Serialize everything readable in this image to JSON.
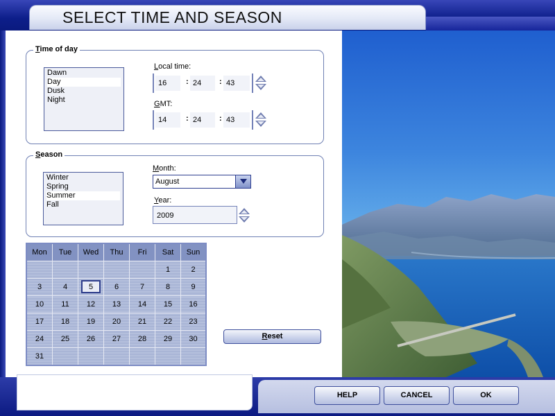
{
  "window": {
    "title": "SELECT TIME AND SEASON"
  },
  "time_of_day": {
    "legend_key": "T",
    "legend_rest": "ime of day",
    "options": [
      "Dawn",
      "Day",
      "Dusk",
      "Night"
    ],
    "selected": "Day",
    "local_time": {
      "label_key": "L",
      "label_rest": "ocal time:",
      "hours": "16",
      "minutes": "24",
      "seconds": "43"
    },
    "gmt": {
      "label_key": "G",
      "label_rest": "MT:",
      "hours": "14",
      "minutes": "24",
      "seconds": "43"
    },
    "separator": ":"
  },
  "season": {
    "legend_key": "S",
    "legend_rest": "eason",
    "options": [
      "Winter",
      "Spring",
      "Summer",
      "Fall"
    ],
    "selected": "Summer",
    "month": {
      "label_key": "M",
      "label_rest": "onth:",
      "value": "August"
    },
    "year": {
      "label_key": "Y",
      "label_rest": "ear:",
      "value": "2009"
    }
  },
  "calendar": {
    "headers": [
      "Mon",
      "Tue",
      "Wed",
      "Thu",
      "Fri",
      "Sat",
      "Sun"
    ],
    "weeks": [
      [
        "",
        "",
        "",
        "",
        "",
        "1",
        "2"
      ],
      [
        "3",
        "4",
        "5",
        "6",
        "7",
        "8",
        "9"
      ],
      [
        "10",
        "11",
        "12",
        "13",
        "14",
        "15",
        "16"
      ],
      [
        "17",
        "18",
        "19",
        "20",
        "21",
        "22",
        "23"
      ],
      [
        "24",
        "25",
        "26",
        "27",
        "28",
        "29",
        "30"
      ],
      [
        "31",
        "",
        "",
        "",
        "",
        "",
        ""
      ]
    ],
    "selected_day": "5"
  },
  "buttons": {
    "reset_key": "R",
    "reset_rest": "eset",
    "help": "HELP",
    "cancel": "CANCEL",
    "ok": "OK"
  },
  "colors": {
    "frame_blue": "#0b1f86",
    "panel_blue": "#8292c2",
    "accent_border": "#6e7fb3"
  }
}
